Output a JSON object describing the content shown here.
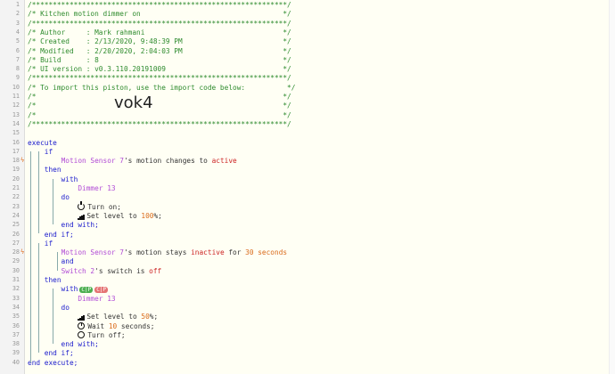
{
  "import_code": "vok4",
  "lines": [
    {
      "n": "1",
      "segs": [
        {
          "t": "/*************************************************************/",
          "c": "c"
        }
      ]
    },
    {
      "n": "2",
      "segs": [
        {
          "t": "/* Kitchen motion dimmer on                                  */",
          "c": "c"
        }
      ]
    },
    {
      "n": "3",
      "segs": [
        {
          "t": "/*************************************************************/",
          "c": "c"
        }
      ]
    },
    {
      "n": "4",
      "segs": [
        {
          "t": "/* Author     : Mark rahmani                                 */",
          "c": "c"
        }
      ]
    },
    {
      "n": "5",
      "segs": [
        {
          "t": "/* Created    : 2/13/2020, 9:48:39 PM                        */",
          "c": "c"
        }
      ]
    },
    {
      "n": "6",
      "segs": [
        {
          "t": "/* Modified   : 2/20/2020, 2:04:03 PM                        */",
          "c": "c"
        }
      ]
    },
    {
      "n": "7",
      "segs": [
        {
          "t": "/* Build      : 8                                            */",
          "c": "c"
        }
      ]
    },
    {
      "n": "8",
      "segs": [
        {
          "t": "/* UI version : v0.3.110.20191009                            */",
          "c": "c"
        }
      ]
    },
    {
      "n": "9",
      "segs": [
        {
          "t": "/*************************************************************/",
          "c": "c"
        }
      ]
    },
    {
      "n": "10",
      "segs": [
        {
          "t": "/* To import this piston, use the import code below:          */",
          "c": "c"
        }
      ]
    },
    {
      "n": "11",
      "segs": [
        {
          "t": "/*                                                           */",
          "c": "c"
        }
      ]
    },
    {
      "n": "12",
      "segs": [
        {
          "t": "/*                                                           */",
          "c": "c"
        }
      ]
    },
    {
      "n": "13",
      "segs": [
        {
          "t": "/*                                                           */",
          "c": "c"
        }
      ]
    },
    {
      "n": "14",
      "segs": [
        {
          "t": "/*************************************************************/",
          "c": "c"
        }
      ]
    },
    {
      "n": "15",
      "segs": []
    },
    {
      "n": "16",
      "segs": [
        {
          "t": "execute",
          "c": "kw"
        }
      ]
    },
    {
      "n": "17",
      "segs": [
        {
          "t": "    if",
          "c": "kw"
        }
      ]
    },
    {
      "n": "18",
      "bolt": true,
      "segs": [
        {
          "t": "        ",
          "c": ""
        },
        {
          "t": "Motion Sensor 7",
          "c": "dev"
        },
        {
          "t": "'s motion changes to ",
          "c": "str"
        },
        {
          "t": "active",
          "c": "val"
        }
      ]
    },
    {
      "n": "19",
      "segs": [
        {
          "t": "    then",
          "c": "kw"
        }
      ]
    },
    {
      "n": "20",
      "segs": [
        {
          "t": "        with",
          "c": "kw"
        }
      ]
    },
    {
      "n": "21",
      "segs": [
        {
          "t": "            ",
          "c": ""
        },
        {
          "t": "Dimmer 13",
          "c": "dev"
        }
      ]
    },
    {
      "n": "22",
      "segs": [
        {
          "t": "        do",
          "c": "kw"
        }
      ]
    },
    {
      "n": "23",
      "icon": "power",
      "segs": [
        {
          "t": "            ",
          "c": ""
        },
        {
          "t": "Turn on;",
          "c": "str"
        }
      ]
    },
    {
      "n": "24",
      "icon": "signal",
      "segs": [
        {
          "t": "            ",
          "c": ""
        },
        {
          "t": "Set level to ",
          "c": "str"
        },
        {
          "t": "100",
          "c": "num"
        },
        {
          "t": "%;",
          "c": "str"
        }
      ]
    },
    {
      "n": "25",
      "segs": [
        {
          "t": "        end with;",
          "c": "kw"
        }
      ]
    },
    {
      "n": "26",
      "segs": [
        {
          "t": "    end if;",
          "c": "kw"
        }
      ]
    },
    {
      "n": "27",
      "segs": [
        {
          "t": "    if",
          "c": "kw"
        }
      ]
    },
    {
      "n": "28",
      "bolt": true,
      "segs": [
        {
          "t": "        ",
          "c": ""
        },
        {
          "t": "Motion Sensor 7",
          "c": "dev"
        },
        {
          "t": "'s motion stays ",
          "c": "str"
        },
        {
          "t": "inactive",
          "c": "val"
        },
        {
          "t": " for ",
          "c": "str"
        },
        {
          "t": "30 seconds",
          "c": "num"
        }
      ]
    },
    {
      "n": "29",
      "segs": [
        {
          "t": "        and",
          "c": "kw"
        }
      ]
    },
    {
      "n": "30",
      "segs": [
        {
          "t": "        ",
          "c": ""
        },
        {
          "t": "Switch 2",
          "c": "dev"
        },
        {
          "t": "'s switch is ",
          "c": "str"
        },
        {
          "t": "off",
          "c": "val"
        }
      ]
    },
    {
      "n": "31",
      "segs": [
        {
          "t": "    then",
          "c": "kw"
        }
      ]
    },
    {
      "n": "32",
      "badges": [
        "C|P",
        "C|P"
      ],
      "segs": [
        {
          "t": "        with",
          "c": "kw"
        }
      ]
    },
    {
      "n": "33",
      "segs": [
        {
          "t": "            ",
          "c": ""
        },
        {
          "t": "Dimmer 13",
          "c": "dev"
        }
      ]
    },
    {
      "n": "34",
      "segs": [
        {
          "t": "        do",
          "c": "kw"
        }
      ]
    },
    {
      "n": "35",
      "icon": "signal",
      "segs": [
        {
          "t": "            ",
          "c": ""
        },
        {
          "t": "Set level to ",
          "c": "str"
        },
        {
          "t": "50",
          "c": "num"
        },
        {
          "t": "%;",
          "c": "str"
        }
      ]
    },
    {
      "n": "36",
      "icon": "clock",
      "segs": [
        {
          "t": "            ",
          "c": ""
        },
        {
          "t": "Wait ",
          "c": "str"
        },
        {
          "t": "10",
          "c": "num"
        },
        {
          "t": " seconds;",
          "c": "str"
        }
      ]
    },
    {
      "n": "37",
      "icon": "ring",
      "segs": [
        {
          "t": "            ",
          "c": ""
        },
        {
          "t": "Turn off;",
          "c": "str"
        }
      ]
    },
    {
      "n": "38",
      "segs": [
        {
          "t": "        end with;",
          "c": "kw"
        }
      ]
    },
    {
      "n": "39",
      "segs": [
        {
          "t": "    end if;",
          "c": "kw"
        }
      ]
    },
    {
      "n": "40",
      "segs": [
        {
          "t": "end execute;",
          "c": "kw"
        }
      ]
    }
  ],
  "icons": {
    "bolt": "lightning-bolt-icon",
    "power": "power-icon",
    "signal": "signal-bars-icon",
    "clock": "clock-icon",
    "ring": "power-off-icon"
  }
}
